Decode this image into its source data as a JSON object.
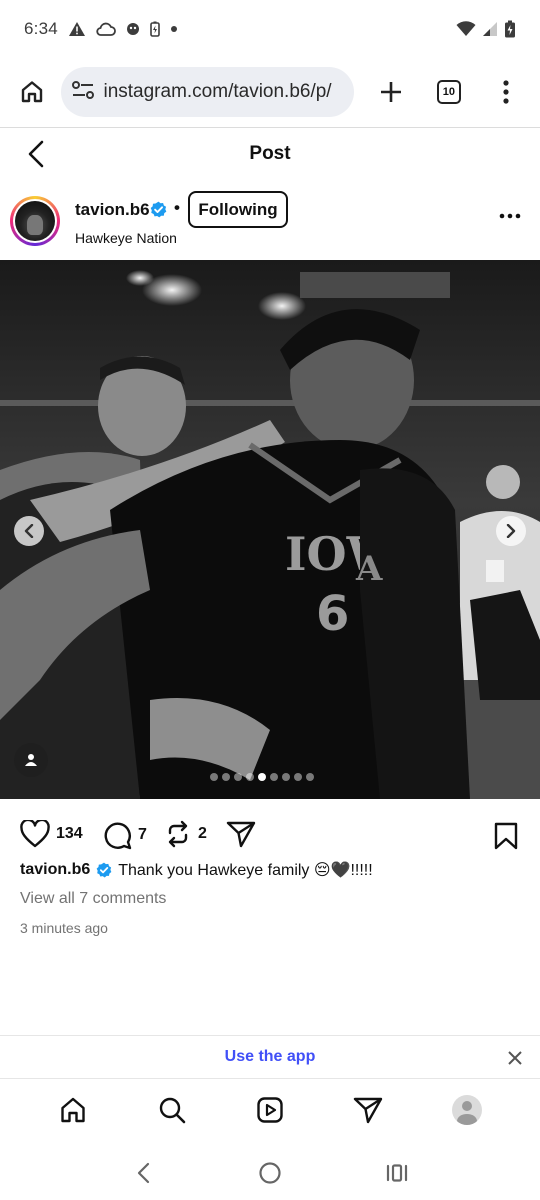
{
  "status_bar": {
    "time": "6:34"
  },
  "browser": {
    "url": "instagram.com/tavion.b6/p/",
    "tab_count": "10"
  },
  "header": {
    "title": "Post"
  },
  "post": {
    "username": "tavion.b6",
    "separator": "•",
    "follow_label": "Following",
    "location": "Hawkeye Nation",
    "carousel": {
      "total": 9,
      "active_index": 4
    },
    "likes": "134",
    "comments": "7",
    "reposts": "2",
    "caption": "Thank you Hawkeye family 😔🖤!!!!!",
    "view_comments": "View all 7 comments",
    "timestamp": "3 minutes ago"
  },
  "banner": {
    "use_app_label": "Use the app"
  },
  "colors": {
    "verified": "#1d9bf0",
    "link": "#4150f7",
    "muted": "#737373"
  },
  "icons": {
    "bottom_nav": [
      "home-icon",
      "search-icon",
      "reels-icon",
      "direct-icon",
      "profile-avatar"
    ]
  }
}
